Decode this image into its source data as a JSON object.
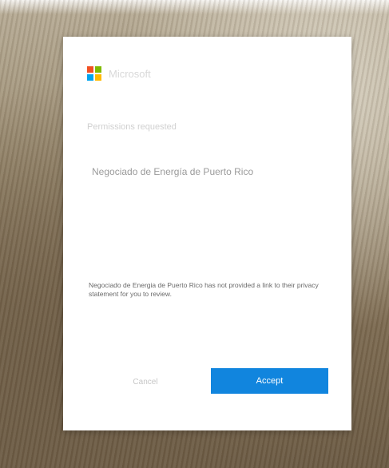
{
  "logo": {
    "text": "Microsoft",
    "colors": [
      "#f25022",
      "#7fba00",
      "#00a4ef",
      "#ffb900"
    ]
  },
  "dialog": {
    "account": "",
    "title_prompt": "Permissions requested",
    "app_name": "Negociado de Energía de Puerto Rico",
    "description": "",
    "scope": "",
    "privacy_lead": "",
    "privacy_app": "Negociado de Energia de",
    "privacy_body": "Puerto Rico has not provided a link to their privacy statement for you to review.",
    "privacy_tail": ""
  },
  "buttons": {
    "cancel": "Cancel",
    "accept": "Accept"
  },
  "colors": {
    "accent": "#1185de"
  }
}
